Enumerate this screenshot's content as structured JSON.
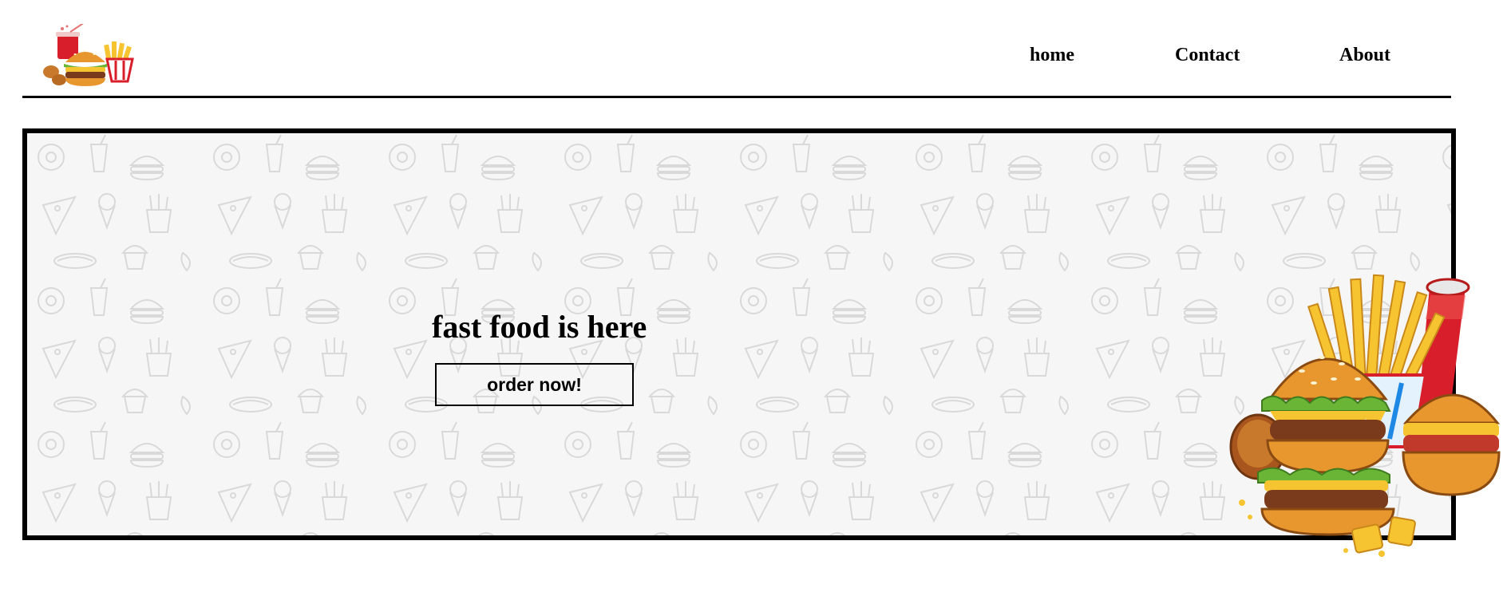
{
  "nav": {
    "items": [
      {
        "label": "home"
      },
      {
        "label": "Contact"
      },
      {
        "label": "About"
      }
    ]
  },
  "hero": {
    "title": "fast food is here",
    "button_label": "order now!"
  },
  "colors": {
    "border": "#000000",
    "pattern_bg": "#f6f6f6",
    "pattern_line": "#d9d9d9",
    "bun": "#e8962e",
    "fries": "#f6c431",
    "cup": "#d81e2a",
    "lettuce": "#6ab536",
    "patty": "#7a3b1c"
  },
  "icons": {
    "logo": "fast-food-combo-logo",
    "hero_image": "burger-fries-drink-combo"
  }
}
